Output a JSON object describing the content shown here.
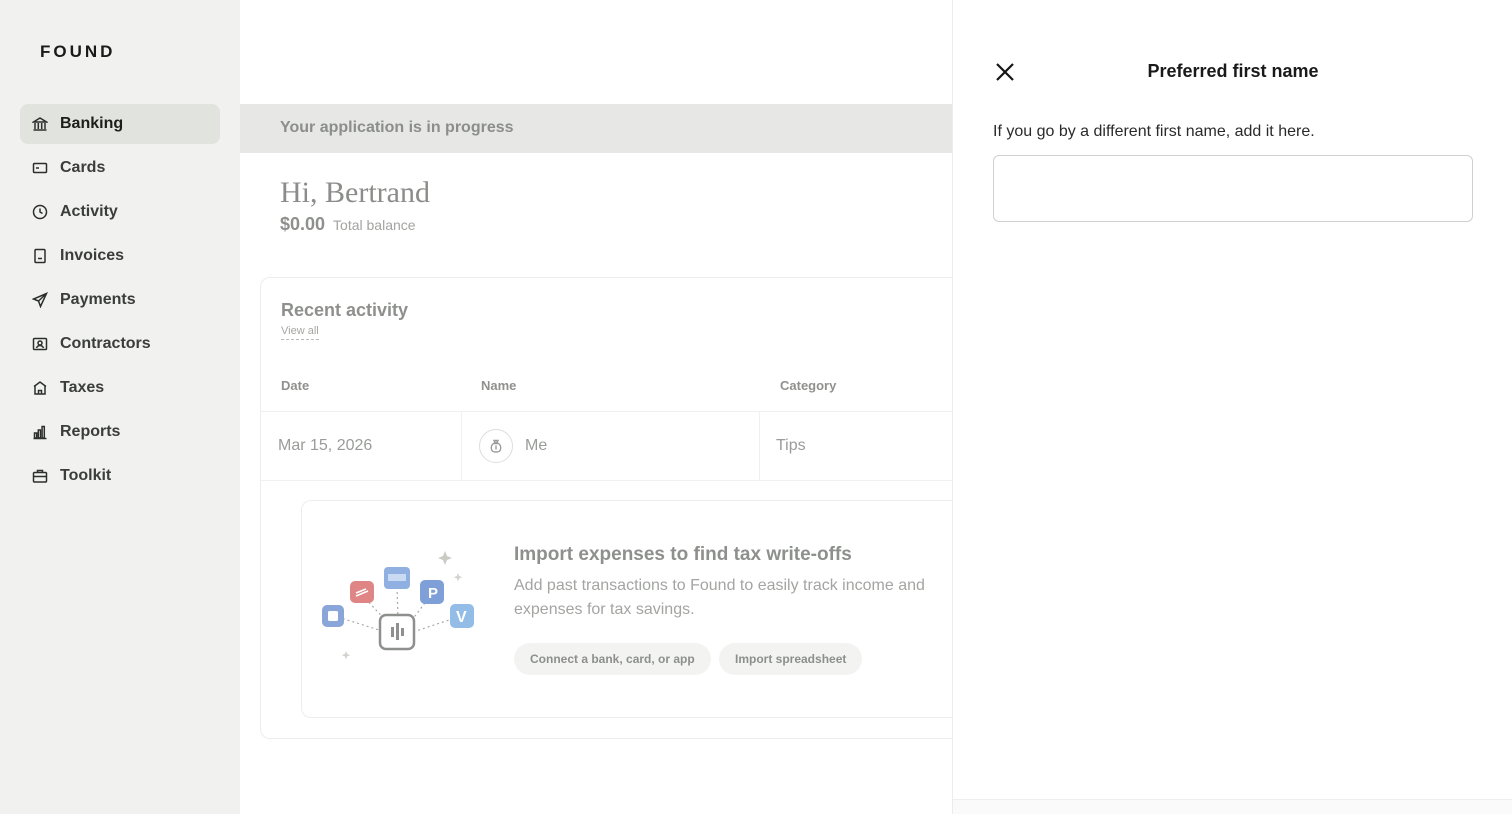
{
  "app": {
    "logo": "FOUND"
  },
  "sidebar": {
    "items": [
      {
        "label": "Banking",
        "icon": "bank-icon",
        "active": true
      },
      {
        "label": "Cards",
        "icon": "card-icon"
      },
      {
        "label": "Activity",
        "icon": "clock-icon"
      },
      {
        "label": "Invoices",
        "icon": "invoice-icon"
      },
      {
        "label": "Payments",
        "icon": "send-icon"
      },
      {
        "label": "Contractors",
        "icon": "contractor-icon"
      },
      {
        "label": "Taxes",
        "icon": "tax-building-icon"
      },
      {
        "label": "Reports",
        "icon": "bar-chart-icon"
      },
      {
        "label": "Toolkit",
        "icon": "briefcase-icon"
      }
    ]
  },
  "main": {
    "banner": "Your application is in progress",
    "greeting": "Hi, Bertrand",
    "balance": {
      "amount": "$0.00",
      "label": "Total balance"
    },
    "recent": {
      "title": "Recent activity",
      "view_all": "View all",
      "columns": [
        "Date",
        "Name",
        "Category"
      ],
      "rows": [
        {
          "date": "Mar 15, 2026",
          "name": "Me",
          "category": "Tips"
        }
      ]
    },
    "import": {
      "title": "Import expenses to find tax write-offs",
      "description": "Add past transactions to Found to easily track income and expenses for tax savings.",
      "connect_label": "Connect a bank, card, or app",
      "spreadsheet_label": "Import spreadsheet"
    }
  },
  "panel": {
    "title": "Preferred first name",
    "description": "If you go by a different first name, add it here.",
    "input_value": "",
    "input_placeholder": ""
  },
  "colors": {
    "sidebar_bg": "#f1f2ef",
    "active_item_bg": "#e1e4de",
    "banner_bg": "#e7e8e6"
  }
}
